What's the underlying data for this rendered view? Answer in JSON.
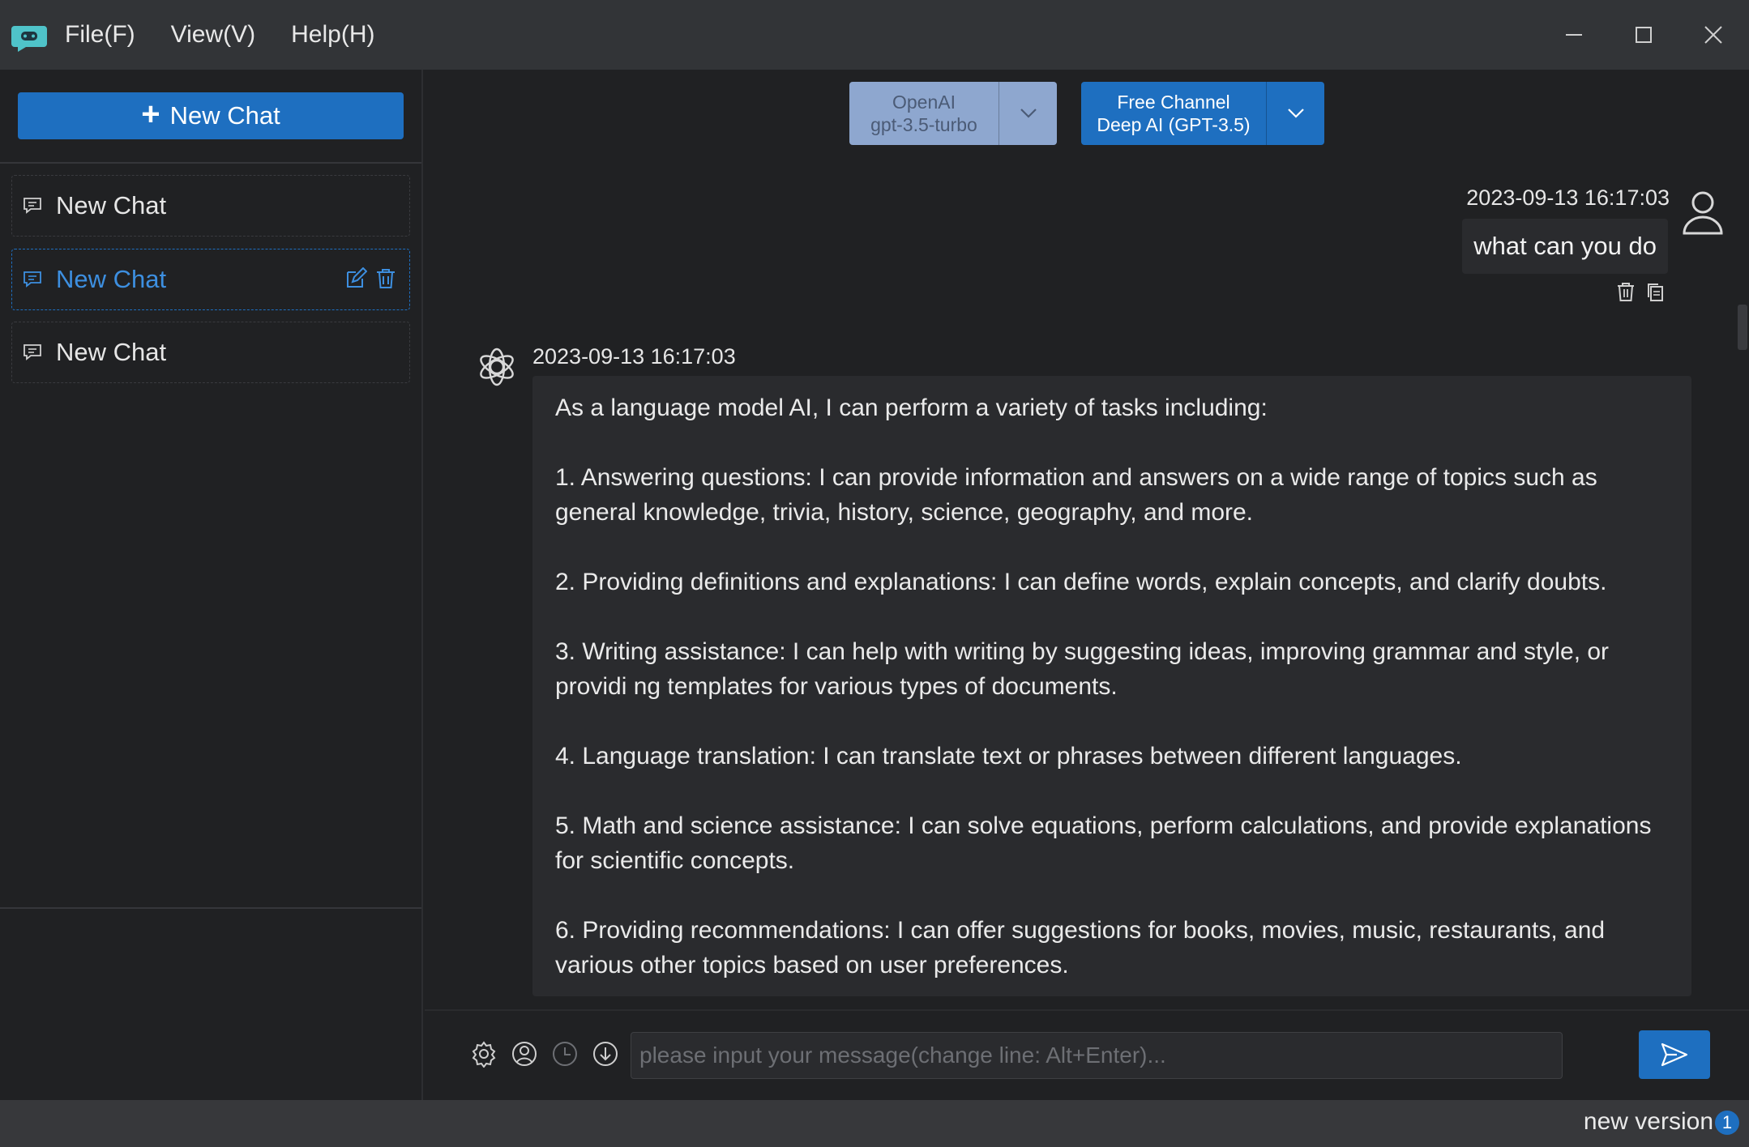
{
  "menu": {
    "items": [
      {
        "label": "File(F)"
      },
      {
        "label": "View(V)"
      },
      {
        "label": "Help(H)"
      }
    ]
  },
  "sidebar": {
    "new_chat_label": "New Chat",
    "chats": [
      {
        "label": "New Chat",
        "active": false
      },
      {
        "label": "New Chat",
        "active": true
      },
      {
        "label": "New Chat",
        "active": false
      }
    ]
  },
  "model_selectors": {
    "provider": {
      "line1": "OpenAI",
      "line2": "gpt-3.5-turbo"
    },
    "channel": {
      "line1": "Free Channel",
      "line2": "Deep AI (GPT-3.5)"
    }
  },
  "conversation": {
    "user_message": {
      "timestamp": "2023-09-13 16:17:03",
      "text": "what can you do"
    },
    "bot_message": {
      "timestamp": "2023-09-13 16:17:03",
      "paragraphs": [
        "As a language model AI, I can perform a variety of tasks including:",
        "1. Answering questions: I can provide information and answers on a wide range of topics such as general knowledge, trivia, history, science, geography, and more.",
        "2. Providing definitions and explanations: I can define words, explain concepts, and clarify doubts.",
        "3. Writing assistance: I can help with writing by suggesting ideas, improving grammar and style, or providi ng templates for various types of documents.",
        "4. Language translation: I can translate text or phrases between different languages.",
        "5. Math and science assistance: I can solve equations, perform calculations, and provide explanations for scientific concepts.",
        "6. Providing recommendations: I can offer suggestions for books, movies, music, restaurants, and various other topics based on user preferences."
      ]
    }
  },
  "input": {
    "placeholder": "please input your message(change line: Alt+Enter)..."
  },
  "statusbar": {
    "new_version_label": "new version",
    "badge_count": "1"
  },
  "colors": {
    "accent": "#1e6fc0",
    "background": "#202123",
    "titlebar": "#323437",
    "bubble": "#2a2b2e"
  }
}
